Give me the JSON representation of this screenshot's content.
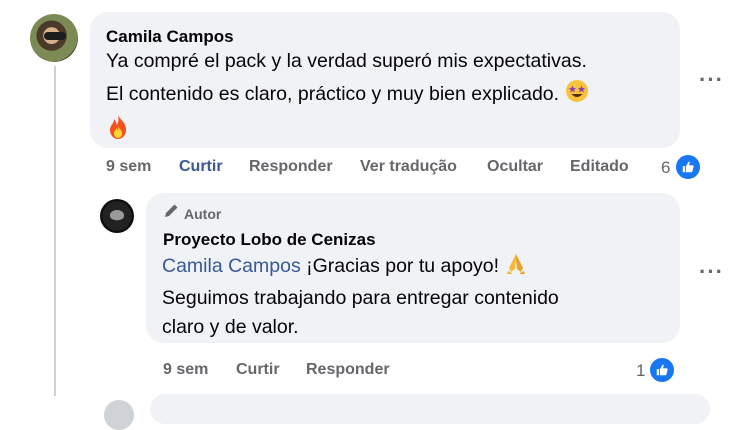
{
  "comment": {
    "author": "Camila Campos",
    "line1": "Ya compré el pack y la verdad superó mis expectativas.",
    "line2": "El contenido es claro, práctico y muy bien explicado.",
    "time": "9 sem",
    "like_label": "Curtir",
    "reply_label": "Responder",
    "translate_label": "Ver tradução",
    "hide_label": "Ocultar",
    "edited_label": "Editado",
    "reaction_count": "6"
  },
  "reply": {
    "author_badge": "Autor",
    "author": "Proyecto Lobo de Cenizas",
    "mention": "Camila Campos",
    "line1_rest": " ¡Gracias por tu apoyo!",
    "line2": "Seguimos trabajando para entregar contenido",
    "line3": "claro y de valor.",
    "time": "9 sem",
    "like_label": "Curtir",
    "reply_label": "Responder",
    "reaction_count": "1"
  },
  "icons": {
    "more": "more-options-icon",
    "like": "thumbs-up-icon",
    "star_eyes": "star-struck-emoji",
    "fire": "fire-emoji",
    "pray": "folded-hands-emoji",
    "pen": "author-pen-icon"
  },
  "colors": {
    "bubble": "#f0f2f5",
    "link": "#385898",
    "meta": "#65676b",
    "like_blue": "#1877f2"
  }
}
